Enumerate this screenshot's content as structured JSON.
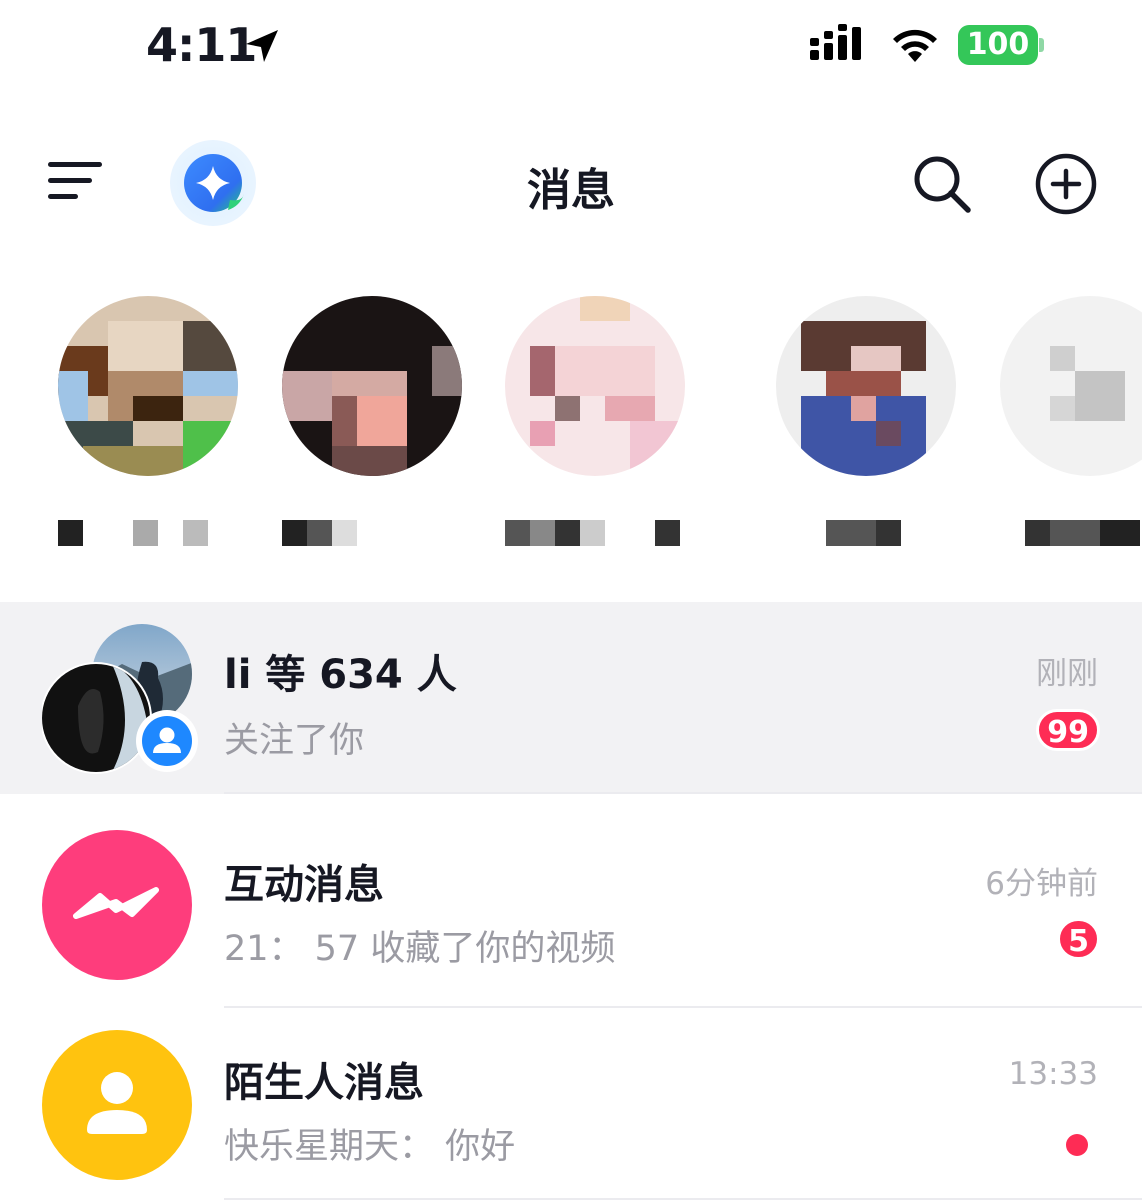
{
  "status_bar": {
    "time": "4:11",
    "battery": "100"
  },
  "nav": {
    "title": "消息"
  },
  "friends": [
    {
      "id": "friend-1"
    },
    {
      "id": "friend-2"
    },
    {
      "id": "friend-3"
    },
    {
      "id": "friend-4"
    },
    {
      "id": "friend-5"
    }
  ],
  "messages": [
    {
      "title": "li 等 634 人",
      "subtitle": "关注了你",
      "time": "刚刚",
      "badge": "99",
      "icon": "followers-avatar-stack"
    },
    {
      "title": "互动消息",
      "subtitle": "21： 57 收藏了你的视频",
      "time": "6分钟前",
      "badge": "5",
      "icon": "interaction-icon"
    },
    {
      "title": "陌生人消息",
      "subtitle": "快乐星期天： 你好",
      "time": "13:33",
      "icon": "stranger-icon"
    }
  ],
  "colors": {
    "accent_red": "#fe2c55",
    "interaction_pink": "#fe3d7c",
    "stranger_yellow": "#ffc30f",
    "follow_blue": "#1e88ff",
    "battery_green": "#34c759"
  }
}
